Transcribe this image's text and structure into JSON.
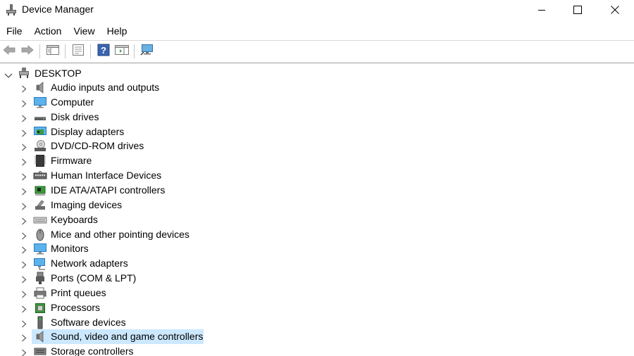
{
  "window": {
    "title": "Device Manager",
    "controls": [
      "minimize",
      "maximize",
      "close"
    ]
  },
  "menu": [
    "File",
    "Action",
    "View",
    "Help"
  ],
  "toolbar": [
    "back-arrow-icon",
    "forward-arrow-icon",
    "show-hide-console-tree-icon",
    "properties-icon",
    "help-icon",
    "action-pane-icon",
    "scan-hardware-icon"
  ],
  "tree": {
    "root": "DESKTOP",
    "items": [
      {
        "label": "Audio inputs and outputs",
        "icon": "speaker-icon"
      },
      {
        "label": "Computer",
        "icon": "computer-icon"
      },
      {
        "label": "Disk drives",
        "icon": "disk-drive-icon"
      },
      {
        "label": "Display adapters",
        "icon": "display-adapter-icon"
      },
      {
        "label": "DVD/CD-ROM drives",
        "icon": "dvd-drive-icon"
      },
      {
        "label": "Firmware",
        "icon": "firmware-icon"
      },
      {
        "label": "Human Interface Devices",
        "icon": "hid-icon"
      },
      {
        "label": "IDE ATA/ATAPI controllers",
        "icon": "ide-controller-icon"
      },
      {
        "label": "Imaging devices",
        "icon": "camera-icon"
      },
      {
        "label": "Keyboards",
        "icon": "keyboard-icon"
      },
      {
        "label": "Mice and other pointing devices",
        "icon": "mouse-icon"
      },
      {
        "label": "Monitors",
        "icon": "monitor-icon"
      },
      {
        "label": "Network adapters",
        "icon": "network-adapter-icon"
      },
      {
        "label": "Ports (COM & LPT)",
        "icon": "port-icon"
      },
      {
        "label": "Print queues",
        "icon": "printer-icon"
      },
      {
        "label": "Processors",
        "icon": "processor-icon"
      },
      {
        "label": "Software devices",
        "icon": "software-device-icon"
      },
      {
        "label": "Sound, video and game controllers",
        "icon": "speaker-icon",
        "selected": true
      },
      {
        "label": "Storage controllers",
        "icon": "storage-controller-icon"
      }
    ]
  }
}
